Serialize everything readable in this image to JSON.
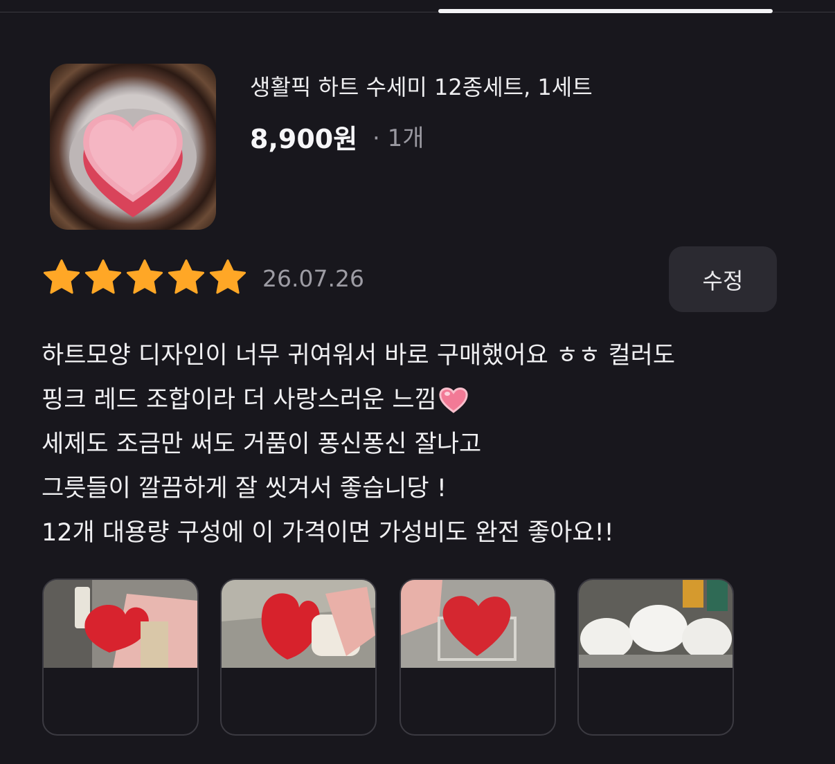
{
  "product": {
    "title": "생활픽 하트 수세미 12종세트, 1세트",
    "price": "8,900원",
    "quantity": "· 1개"
  },
  "review": {
    "rating": 5,
    "rating_max": 5,
    "date": "26.07.26",
    "edit_label": "수정",
    "lines": [
      "하트모양 디자인이 너무 귀여워서 바로 구매했어요 ㅎㅎ 컬러도",
      "핑크 레드 조합이라 더 사랑스러운 느낌",
      "세제도 조금만 써도 거품이 퐁신퐁신 잘나고",
      "그릇들이 깔끔하게 잘 씻겨서 좋습니당 !",
      "12개 대용량 구성에 이 가격이면 가성비도 완전 좋아요!!"
    ]
  },
  "icons": {
    "star": "star-icon",
    "heart_emoji": "pink-heart-emoji"
  },
  "colors": {
    "background": "#18171d",
    "star": "#ffa726",
    "muted_text": "#9a99a1",
    "button_bg": "#2b2a31"
  }
}
